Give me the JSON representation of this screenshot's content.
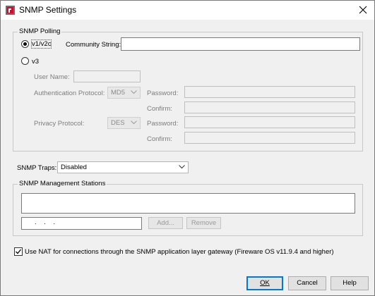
{
  "window": {
    "title": "SNMP Settings",
    "app_icon": "firebox-logo-icon",
    "close_icon": "close-icon"
  },
  "polling": {
    "legend": "SNMP Polling",
    "v1v2c_label": "v1/v2c",
    "v1v2c_selected": true,
    "community_label": "Community String:",
    "community_value": "",
    "v3_label": "v3",
    "v3_selected": false,
    "user_name_label": "User Name:",
    "user_name_value": "",
    "auth_protocol_label": "Authentication Protocol:",
    "auth_protocol_value": "MD5",
    "auth_password_label": "Password:",
    "auth_confirm_label": "Confirm:",
    "privacy_protocol_label": "Privacy Protocol:",
    "privacy_protocol_value": "DES",
    "privacy_password_label": "Password:",
    "privacy_confirm_label": "Confirm:"
  },
  "traps": {
    "label": "SNMP Traps:",
    "value": "Disabled"
  },
  "stations": {
    "legend": "SNMP Management Stations",
    "ip_placeholder": ".    .    .",
    "add_label": "Add...",
    "remove_label": "Remove"
  },
  "nat": {
    "checked": true,
    "label": "Use NAT for connections through the SNMP application layer gateway (Fireware OS v11.9.4 and higher)"
  },
  "buttons": {
    "ok": "OK",
    "cancel": "Cancel",
    "help": "Help"
  },
  "colors": {
    "focus_blue": "#0078d7",
    "logo_red": "#c8102e"
  }
}
